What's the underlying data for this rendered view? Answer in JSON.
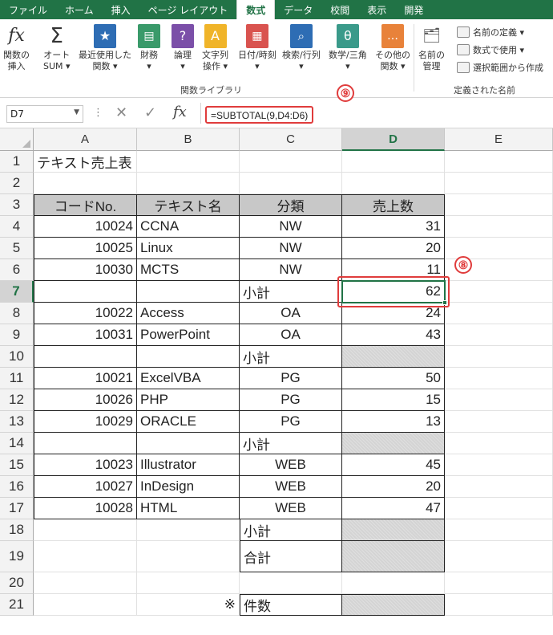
{
  "ribbon_tabs": [
    "ファイル",
    "ホーム",
    "挿入",
    "ページ レイアウト",
    "数式",
    "データ",
    "校閲",
    "表示",
    "開発"
  ],
  "ribbon_buttons": {
    "insert_function": [
      "関数の",
      "挿入"
    ],
    "autosum": [
      "オート",
      "SUM ▾"
    ],
    "recent": [
      "最近使用した",
      "関数 ▾"
    ],
    "financial": [
      "財務",
      "▾"
    ],
    "logical": [
      "論理",
      "▾"
    ],
    "text": [
      "文字列",
      "操作 ▾"
    ],
    "datetime": [
      "日付/時刻",
      "▾"
    ],
    "lookup": [
      "検索/行列",
      "▾"
    ],
    "math": [
      "数学/三角",
      "▾"
    ],
    "more": [
      "その他の",
      "関数 ▾"
    ],
    "name_manager": [
      "名前の",
      "管理"
    ]
  },
  "ribbon_small": {
    "define_name": "名前の定義 ▾",
    "use_in_formula": "数式で使用 ▾",
    "create_from_selection": "選択範囲から作成"
  },
  "group_labels": {
    "function_library": "関数ライブラリ",
    "defined_names": "定義された名前"
  },
  "formula_bar": {
    "name_box": "D7",
    "formula": "=SUBTOTAL(9,D4:D6)"
  },
  "annotations": {
    "badge_formula": "⑨",
    "badge_cell": "⑧"
  },
  "columns": [
    "A",
    "B",
    "C",
    "D",
    "E"
  ],
  "selected_column": "D",
  "selected_row": 7,
  "rows": [
    {
      "n": "1",
      "a": "テキスト売上表",
      "b": "",
      "c": "",
      "d": ""
    },
    {
      "n": "2",
      "a": "",
      "b": "",
      "c": "",
      "d": ""
    },
    {
      "n": "3",
      "a": "コードNo.",
      "b": "テキスト名",
      "c": "分類",
      "d": "売上数"
    },
    {
      "n": "4",
      "a": "10024",
      "b": "CCNA",
      "c": "NW",
      "d": "31"
    },
    {
      "n": "5",
      "a": "10025",
      "b": "Linux",
      "c": "NW",
      "d": "20"
    },
    {
      "n": "6",
      "a": "10030",
      "b": "MCTS",
      "c": "NW",
      "d": "11"
    },
    {
      "n": "7",
      "a": "",
      "b": "",
      "c": "小計",
      "d": "62"
    },
    {
      "n": "8",
      "a": "10022",
      "b": "Access",
      "c": "OA",
      "d": "24"
    },
    {
      "n": "9",
      "a": "10031",
      "b": "PowerPoint",
      "c": "OA",
      "d": "43"
    },
    {
      "n": "10",
      "a": "",
      "b": "",
      "c": "小計",
      "d": ""
    },
    {
      "n": "11",
      "a": "10021",
      "b": "ExcelVBA",
      "c": "PG",
      "d": "50"
    },
    {
      "n": "12",
      "a": "10026",
      "b": "PHP",
      "c": "PG",
      "d": "15"
    },
    {
      "n": "13",
      "a": "10029",
      "b": "ORACLE",
      "c": "PG",
      "d": "13"
    },
    {
      "n": "14",
      "a": "",
      "b": "",
      "c": "小計",
      "d": ""
    },
    {
      "n": "15",
      "a": "10023",
      "b": "Illustrator",
      "c": "WEB",
      "d": "45"
    },
    {
      "n": "16",
      "a": "10027",
      "b": "InDesign",
      "c": "WEB",
      "d": "20"
    },
    {
      "n": "17",
      "a": "10028",
      "b": "HTML",
      "c": "WEB",
      "d": "47"
    },
    {
      "n": "18",
      "a": "",
      "b": "",
      "c": "小計",
      "d": ""
    },
    {
      "n": "19",
      "a": "",
      "b": "",
      "c": "合計",
      "d": ""
    },
    {
      "n": "20",
      "a": "",
      "b": "",
      "c": "",
      "d": ""
    },
    {
      "n": "21",
      "a": "",
      "b": "※",
      "c": "件数",
      "d": ""
    }
  ]
}
